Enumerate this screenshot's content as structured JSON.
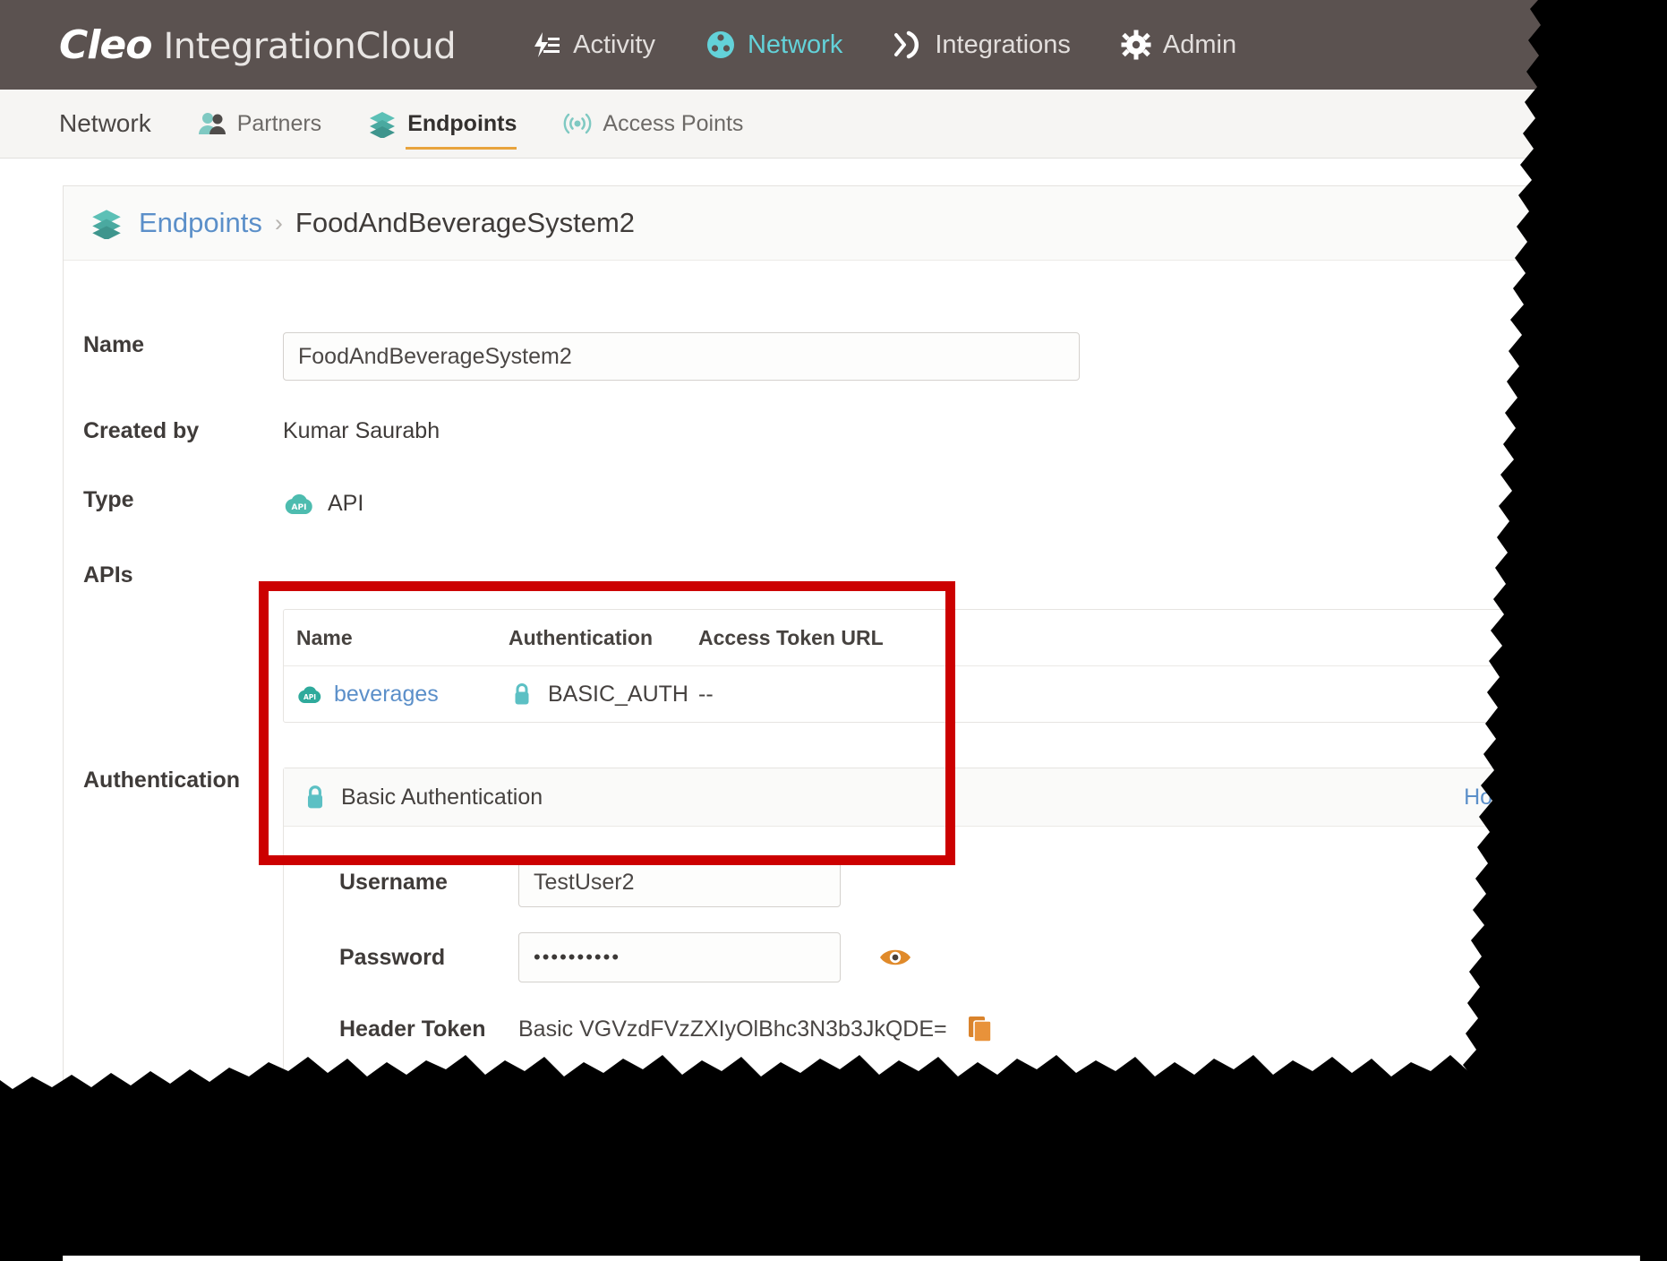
{
  "brand": {
    "name_bold": "Cleo",
    "name_rest": "IntegrationCloud"
  },
  "topnav": {
    "items": [
      {
        "label": "Activity",
        "icon": "activity-icon",
        "active": false
      },
      {
        "label": "Network",
        "icon": "network-icon",
        "active": true
      },
      {
        "label": "Integrations",
        "icon": "integrations-icon",
        "active": false
      },
      {
        "label": "Admin",
        "icon": "gear-icon",
        "active": false
      }
    ]
  },
  "subnav": {
    "title": "Network",
    "tabs": [
      {
        "label": "Partners",
        "icon": "partners-icon",
        "active": false
      },
      {
        "label": "Endpoints",
        "icon": "endpoints-icon",
        "active": true
      },
      {
        "label": "Access Points",
        "icon": "access-points-icon",
        "active": false
      }
    ]
  },
  "breadcrumb": {
    "icon": "endpoints-icon",
    "parent": "Endpoints",
    "separator": "›",
    "current": "FoodAndBeverageSystem2"
  },
  "form": {
    "name_label": "Name",
    "name_value": "FoodAndBeverageSystem2",
    "created_by_label": "Created by",
    "created_by_value": "Kumar Saurabh",
    "type_label": "Type",
    "type_value": "API",
    "type_icon": "api-cloud-icon",
    "apis_label": "APIs",
    "authentication_label": "Authentication"
  },
  "apis_table": {
    "edit_icon": "pencil-icon",
    "columns": [
      "Name",
      "Authentication",
      "Access Token URL"
    ],
    "rows": [
      {
        "name": "beverages",
        "name_icon": "api-cloud-icon",
        "auth": "BASIC_AUTH",
        "auth_icon": "lock-icon",
        "access_token_url": "--"
      }
    ]
  },
  "auth_panel": {
    "header_icon": "lock-icon",
    "header_title": "Basic Authentication",
    "how_to_use": "How to use...",
    "username_label": "Username",
    "username_value": "TestUser2",
    "password_label": "Password",
    "password_value": "••••••••••",
    "show_password_icon": "eye-icon",
    "header_token_label": "Header Token",
    "header_token_value": "Basic VGVzdFVzZXIyOlBhc3N3b3JkQDE=",
    "copy_icon": "copy-icon"
  },
  "colors": {
    "topbar_bg": "#5b5250",
    "accent_teal": "#63d2d9",
    "accent_orange": "#e8a33d",
    "link_blue": "#5b8fc9",
    "highlight_red": "#cc0000",
    "icon_teal": "#5cc0b6"
  }
}
